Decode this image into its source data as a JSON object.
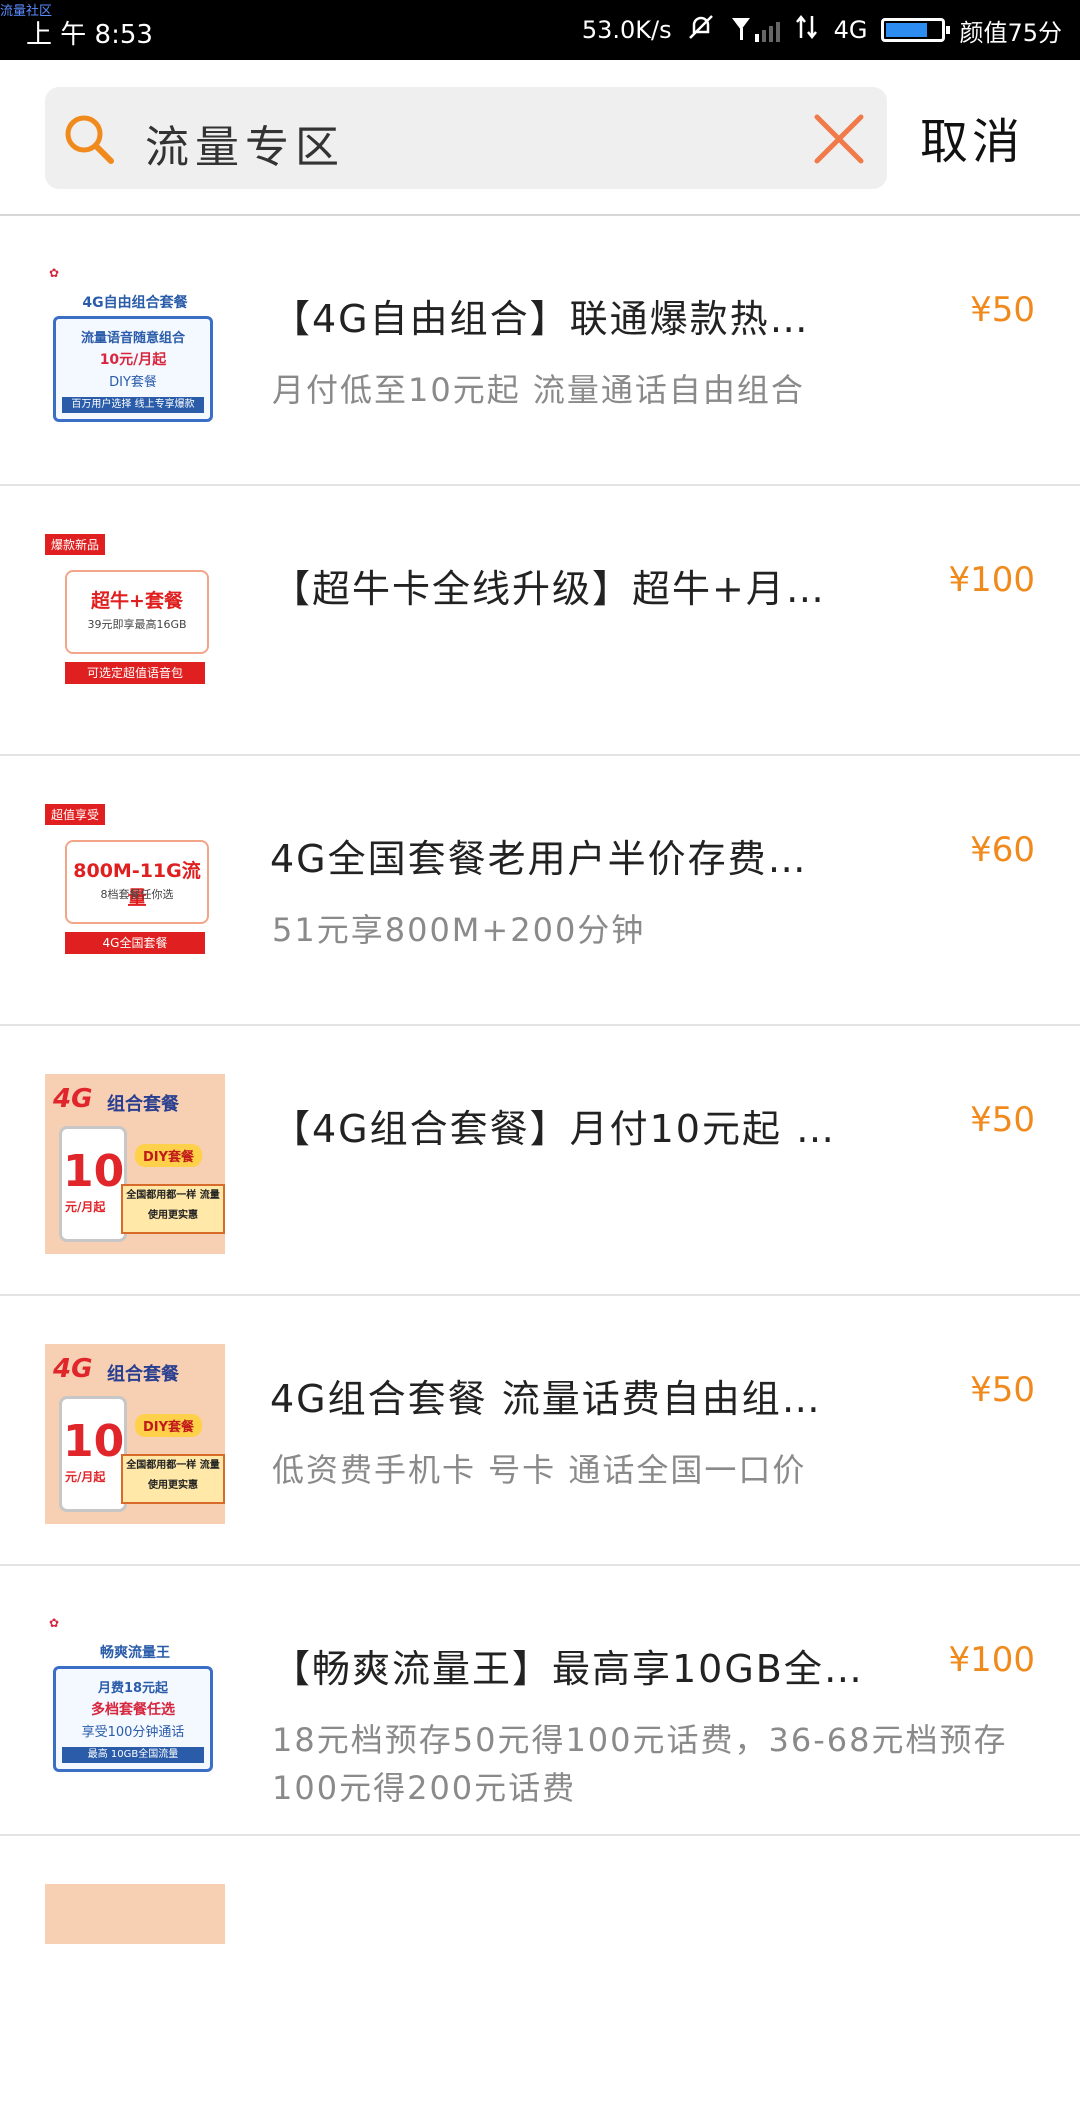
{
  "status_bar": {
    "overlay_label": "流量社区",
    "time": "上 午 8:53",
    "net_speed": "53.0K/s",
    "network": "4G",
    "battery_text": "颜值75分",
    "battery_level": 0.75
  },
  "search": {
    "query": "流量专区",
    "cancel_label": "取消"
  },
  "colors": {
    "accent": "#f08a1c",
    "price": "#f08a1c"
  },
  "items": [
    {
      "title": "【4G自由组合】联通爆款热…",
      "desc": "月付低至10元起 流量通话自由组合",
      "price": "¥50",
      "thumb": {
        "style": "blue",
        "band": "4G自由组合套餐",
        "l1": "流量语音随意组合",
        "l2": "10元/月起",
        "l3": "DIY套餐",
        "l4": "百万用户选择 线上专享爆款"
      }
    },
    {
      "title": "【超牛卡全线升级】超牛+月…",
      "desc": "",
      "price": "¥100",
      "thumb": {
        "style": "red",
        "tag": "爆款新品",
        "big": "超牛+套餐",
        "small": "39元即享最高16GB",
        "strip": "可选定超值语音包"
      }
    },
    {
      "title": "4G全国套餐老用户半价存费…",
      "desc": "51元享800M+200分钟",
      "price": "¥60",
      "thumb": {
        "style": "red",
        "tag": "超值享受",
        "big": "800M-11G流量",
        "small": "8档套餐任你选",
        "strip": "4G全国套餐"
      }
    },
    {
      "title": "【4G组合套餐】月付10元起 …",
      "desc": "",
      "price": "¥50",
      "thumb": {
        "style": "orange",
        "head": "4G",
        "head2": "组合套餐",
        "ten": "10",
        "ten2": "元/月起",
        "pill": "DIY套餐",
        "box": "全国都用都一样 流量使用更实惠"
      }
    },
    {
      "title": "4G组合套餐 流量话费自由组…",
      "desc": "低资费手机卡 号卡 通话全国一口价",
      "price": "¥50",
      "thumb": {
        "style": "orange",
        "head": "4G",
        "head2": "组合套餐",
        "ten": "10",
        "ten2": "元/月起",
        "pill": "DIY套餐",
        "box": "全国都用都一样 流量使用更实惠"
      }
    },
    {
      "title": "【畅爽流量王】最高享10GB全…",
      "desc": "18元档预存50元得100元话费，36-68元档预存100元得200元话费",
      "price": "¥100",
      "thumb": {
        "style": "blue",
        "band": "畅爽流量王",
        "l1": "月费18元起",
        "l2": "多档套餐任选",
        "l3": "享受100分钟通话",
        "l4": "最高 10GB全国流量"
      }
    }
  ]
}
